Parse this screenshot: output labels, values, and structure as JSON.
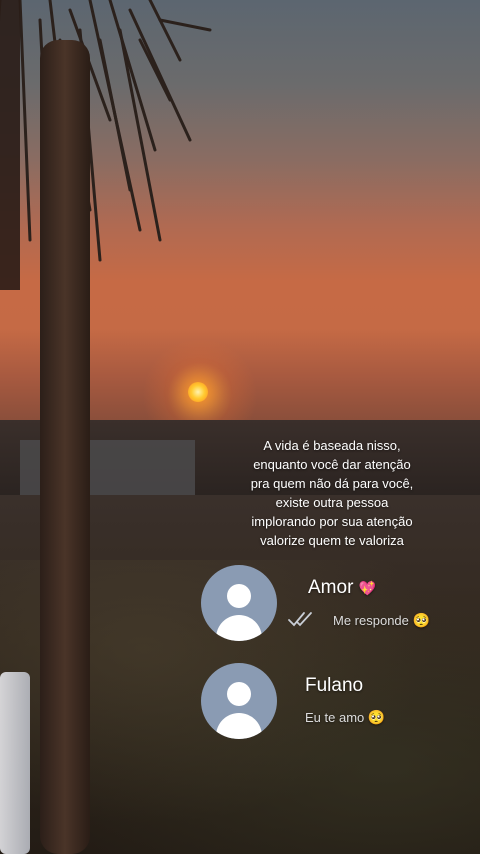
{
  "caption": {
    "line1": "A vida é baseada nisso,",
    "line2": "enquanto você dar atenção",
    "line3": "pra quem não dá para você,",
    "line4": "existe outra pessoa",
    "line5": "implorando por sua atenção",
    "line6": "valorize quem te valoriza"
  },
  "chats": [
    {
      "name": "Amor",
      "name_emoji": "💖",
      "message": "Me responde",
      "message_emoji": "🥺",
      "read_status": "double-check-read"
    },
    {
      "name": "Fulano",
      "message": "Eu te amo",
      "message_emoji": "🥺"
    }
  ],
  "colors": {
    "avatar_bg": "#8a9bb3",
    "text": "#ffffff",
    "message_text": "#dcdcdc"
  }
}
